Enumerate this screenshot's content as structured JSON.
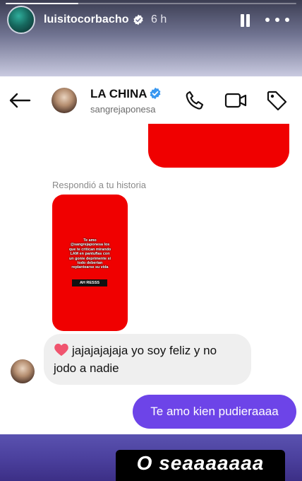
{
  "story": {
    "username": "luisitocorbacho",
    "time": "6 h",
    "progress": 0.25
  },
  "chat": {
    "contact_name": "LA CHINA",
    "contact_handle": "sangrejaponesa",
    "reply_note": "Respondió a tu historia",
    "story_text": "Te amo\n@sangrejaponesa los\nque te critican mirando\nLAM en pantuflas con\nun gonie deprimente si\ntodo deberían\nreplantearse su vida",
    "story_tag": "AH RESSS",
    "incoming_line1": "jajajajajaja yo soy feliz y no",
    "incoming_line2": "jodo a nadie",
    "outgoing": "Te amo kien pudieraaaa"
  },
  "caption": "O seaaaaaaa",
  "colors": {
    "red": "#f00000",
    "accent_purple": "#6d44e8",
    "verified_blue": "#3897f0"
  }
}
